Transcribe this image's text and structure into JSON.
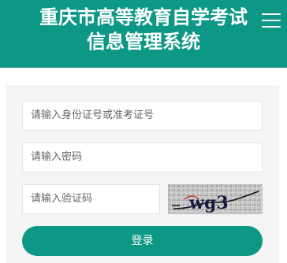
{
  "header": {
    "title_line1": "重庆市高等教育自学考试",
    "title_line2": "信息管理系统",
    "menu_icon": "hamburger-menu-icon"
  },
  "form": {
    "id_field_placeholder": "请输入身份证号或准考证号",
    "password_field_placeholder": "请输入密码",
    "captcha_field_placeholder": "请输入验证码",
    "captcha_text": "wg3",
    "login_label": "登录"
  },
  "colors": {
    "brand": "#0c9885",
    "panel_bg": "#f5f5f5"
  }
}
